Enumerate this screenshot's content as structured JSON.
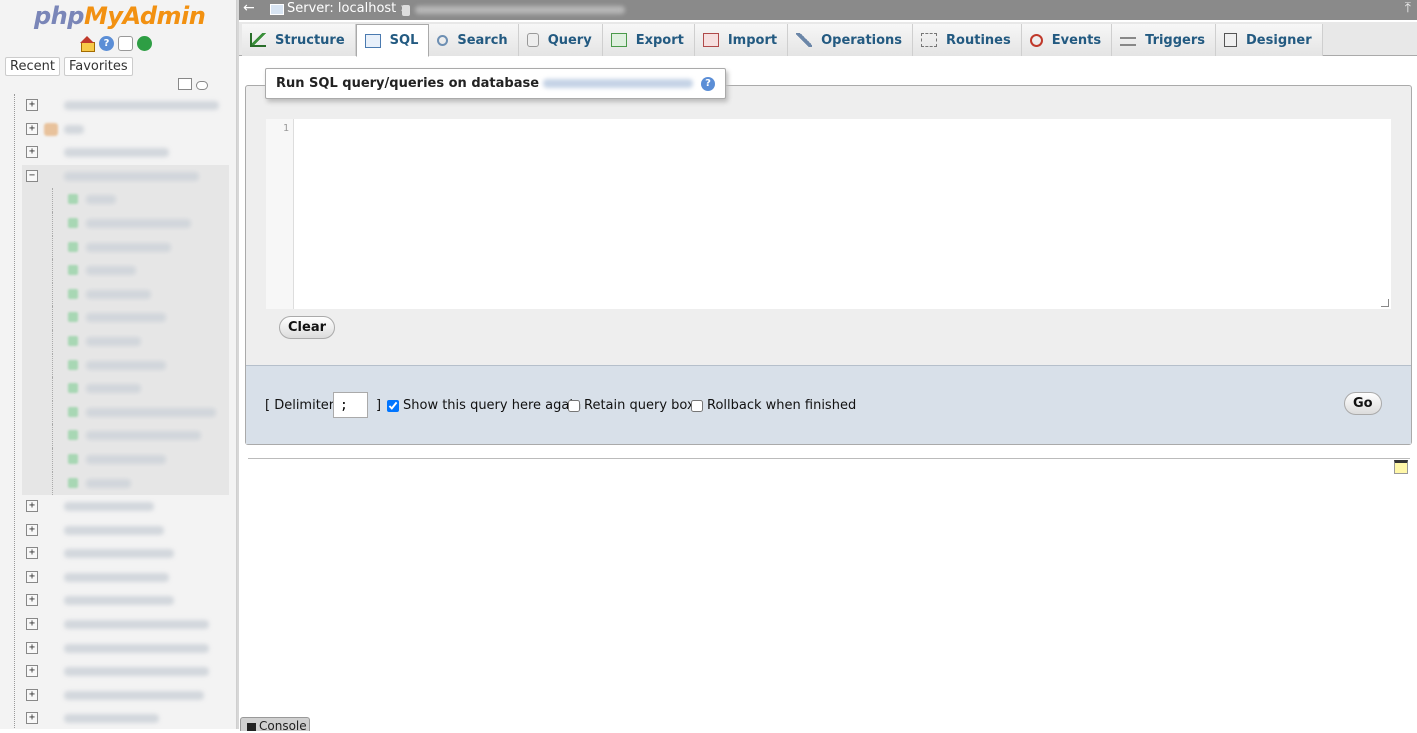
{
  "logo": {
    "php": "php",
    "my": "My",
    "admin": "Admin"
  },
  "nav": {
    "icons": [
      "home-icon",
      "help-icon",
      "docs-icon",
      "reload-icon"
    ],
    "tabs": {
      "recent": "Recent",
      "favorites": "Favorites"
    },
    "tree_row_count_top": 4,
    "tree_children": 13,
    "tree_row_count_bottom": 10
  },
  "topbar": {
    "back": "←",
    "server": "Server: localhost »",
    "collapse": "⤒"
  },
  "tabs": [
    {
      "label": "Structure",
      "icon": "structure-icon"
    },
    {
      "label": "SQL",
      "icon": "sql-icon"
    },
    {
      "label": "Search",
      "icon": "search-icon"
    },
    {
      "label": "Query",
      "icon": "query-icon"
    },
    {
      "label": "Export",
      "icon": "export-icon"
    },
    {
      "label": "Import",
      "icon": "import-icon"
    },
    {
      "label": "Operations",
      "icon": "operations-icon"
    },
    {
      "label": "Routines",
      "icon": "routines-icon"
    },
    {
      "label": "Events",
      "icon": "events-icon"
    },
    {
      "label": "Triggers",
      "icon": "triggers-icon"
    },
    {
      "label": "Designer",
      "icon": "designer-icon"
    }
  ],
  "sql_panel": {
    "legend": "Run SQL query/queries on database",
    "help": "?",
    "line_number": "1",
    "query_value": "",
    "clear_label": "Clear"
  },
  "options": {
    "delimiter_label": "[ Delimiter",
    "delimiter_value": ";",
    "delimiter_close": "]",
    "show_query_label": "Show this query here again",
    "show_query_checked": true,
    "retain_label": "Retain query box",
    "retain_checked": false,
    "rollback_label": "Rollback when finished",
    "rollback_checked": false,
    "go_label": "Go"
  },
  "console": {
    "label": "Console"
  }
}
